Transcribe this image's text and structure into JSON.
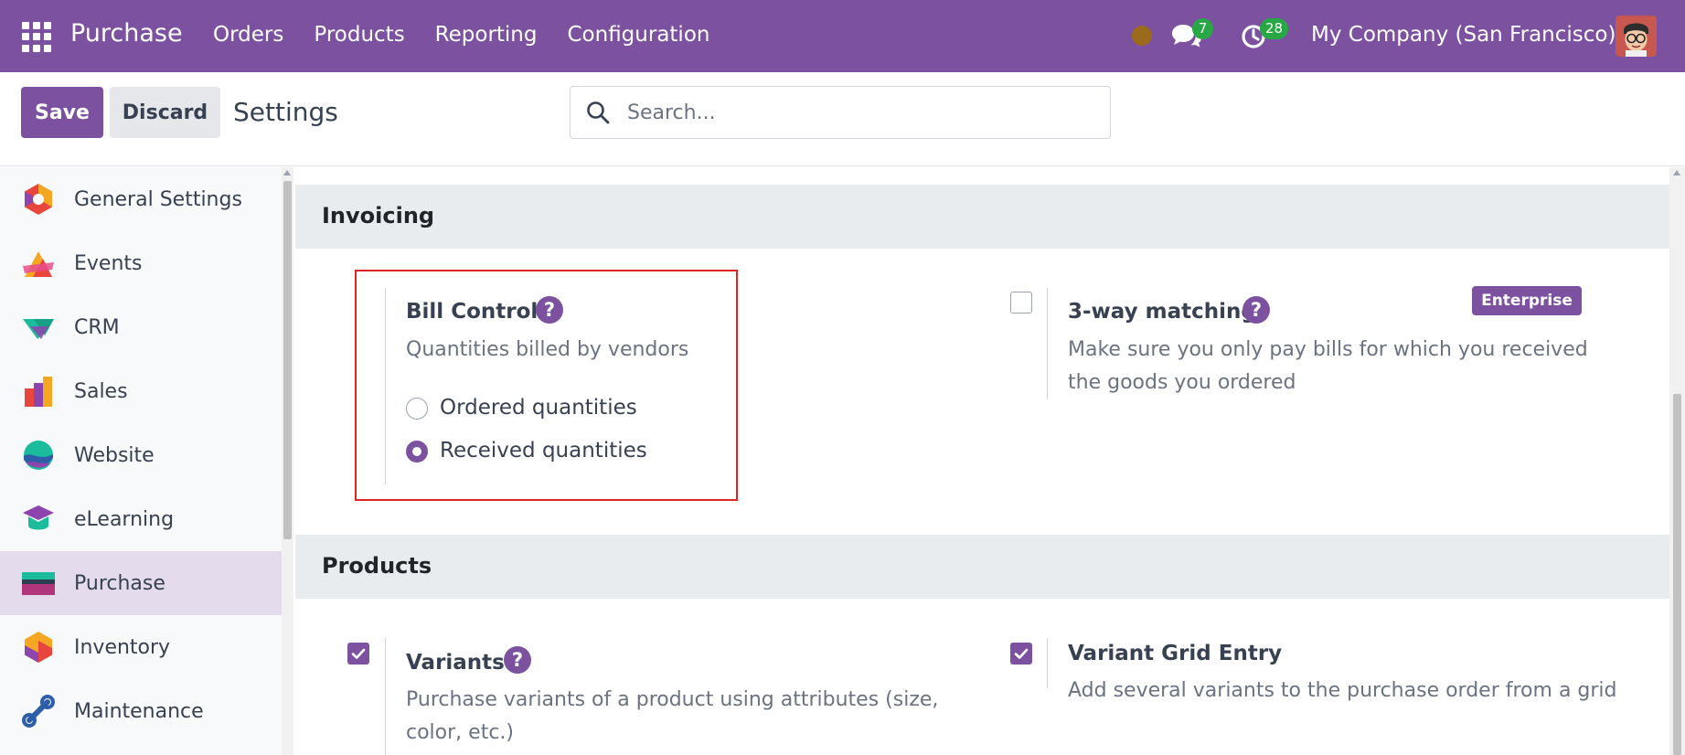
{
  "navbar": {
    "app_name": "Purchase",
    "menu": [
      "Orders",
      "Products",
      "Reporting",
      "Configuration"
    ],
    "messages_count": "7",
    "activities_count": "28",
    "company": "My Company (San Francisco)",
    "colors": {
      "bar": "#7c52a0",
      "badge": "#28a745",
      "status_dot": "#9b6a1a"
    }
  },
  "control_panel": {
    "save_label": "Save",
    "discard_label": "Discard",
    "title": "Settings",
    "search_placeholder": "Search..."
  },
  "sidebar": {
    "active": "Purchase",
    "items": [
      {
        "label": "General Settings",
        "icon": "general-settings-icon"
      },
      {
        "label": "Events",
        "icon": "events-icon"
      },
      {
        "label": "CRM",
        "icon": "crm-icon"
      },
      {
        "label": "Sales",
        "icon": "sales-icon"
      },
      {
        "label": "Website",
        "icon": "website-icon"
      },
      {
        "label": "eLearning",
        "icon": "elearning-icon"
      },
      {
        "label": "Purchase",
        "icon": "purchase-icon"
      },
      {
        "label": "Inventory",
        "icon": "inventory-icon"
      },
      {
        "label": "Maintenance",
        "icon": "maintenance-icon"
      }
    ]
  },
  "invoicing": {
    "title": "Invoicing",
    "bill_control": {
      "title": "Bill Control",
      "description": "Quantities billed by vendors",
      "options": [
        {
          "label": "Ordered quantities",
          "selected": false
        },
        {
          "label": "Received quantities",
          "selected": true
        }
      ]
    },
    "three_way": {
      "title": "3-way matching",
      "description": "Make sure you only pay bills for which you received the goods you ordered",
      "badge": "Enterprise",
      "checked": false
    }
  },
  "products": {
    "title": "Products",
    "variants": {
      "title": "Variants",
      "description": "Purchase variants of a product using attributes (size, color, etc.)",
      "checked": true
    },
    "variant_grid": {
      "title": "Variant Grid Entry",
      "description": "Add several variants to the purchase order from a grid",
      "checked": true
    }
  },
  "help_glyph": "?"
}
